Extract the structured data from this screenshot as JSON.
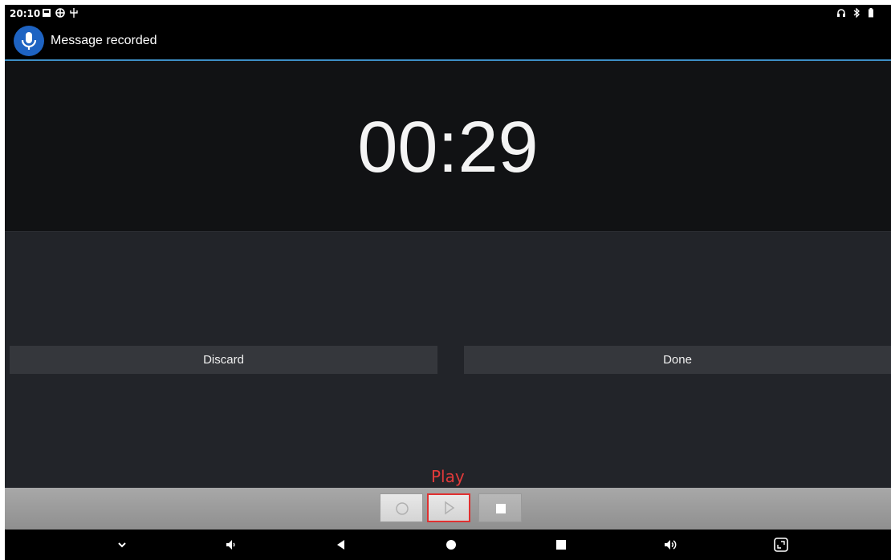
{
  "status_bar": {
    "time": "20:10",
    "left_icons": [
      "sd-card-icon",
      "network-globe-icon",
      "usb-icon"
    ],
    "right_icons": [
      "headset-icon",
      "bluetooth-icon",
      "battery-icon"
    ]
  },
  "header": {
    "app_icon": "microphone-icon",
    "title": "Message recorded",
    "accent_color": "#3d8fc6"
  },
  "timer": {
    "value": "00:29"
  },
  "actions": {
    "discard_label": "Discard",
    "done_label": "Done"
  },
  "annotation": {
    "label": "Play",
    "color": "#e23a3a"
  },
  "controls": {
    "buttons": [
      "record-icon",
      "play-icon",
      "stop-icon"
    ],
    "disabled": [
      "stop"
    ]
  },
  "navigation": {
    "buttons": [
      "chevron-down-icon",
      "volume-down-icon",
      "back-icon",
      "home-icon",
      "recents-icon",
      "volume-up-icon",
      "screenshot-icon"
    ]
  }
}
